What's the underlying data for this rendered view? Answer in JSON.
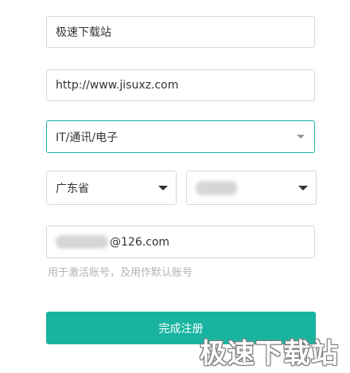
{
  "form": {
    "site_name": "极速下载站",
    "site_url": "http://www.jisuxz.com",
    "industry": "IT/通讯/电子",
    "province": "广东省",
    "email_suffix": "@126.com",
    "email_hint": "用于激活账号，及用作默认账号",
    "submit_label": "完成注册"
  },
  "watermark": "极速下载站",
  "colors": {
    "accent": "#19b4a0",
    "border": "#d6d6d6",
    "hint": "#b3b3b3"
  }
}
